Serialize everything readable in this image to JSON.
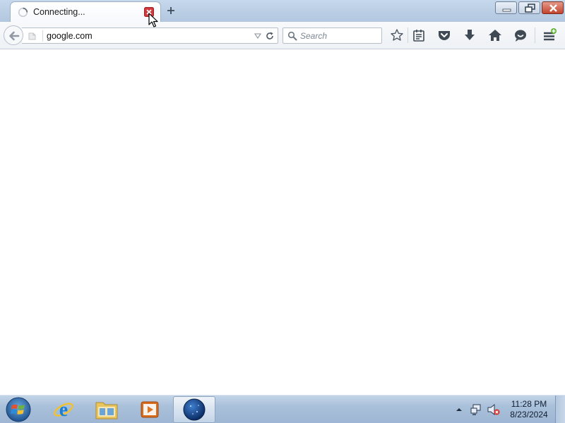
{
  "browser": {
    "tab": {
      "title": "Connecting...",
      "throbber_icon": "loading-throbber-icon",
      "close_icon": "close-tab-icon"
    },
    "new_tab_icon": "plus-icon",
    "window_controls": [
      "minimize",
      "restore",
      "close"
    ],
    "urlbar": {
      "value": "google.com",
      "identity_icon": "page-identity-icon",
      "dropdown_icon": "dropdown-arrow-icon",
      "reload_icon": "reload-icon"
    },
    "search": {
      "placeholder": "Search",
      "icon": "search-icon"
    },
    "toolbar_buttons": [
      "bookmark-star",
      "bookmarks-menu",
      "pocket",
      "downloads",
      "home",
      "hello",
      "menu"
    ],
    "menu_badge_color": "#5fb332"
  },
  "taskbar": {
    "pinned_apps": [
      "Internet Explorer",
      "Windows Explorer",
      "Windows Media Player",
      "Firefox"
    ],
    "active_app": "Firefox",
    "clock": {
      "time": "11:28 PM",
      "date": "8/23/2024"
    },
    "volume_muted": true
  },
  "colors": {
    "tab_strip": "#b9cde4",
    "taskbar": "#a9c0da",
    "close_button": "#c3442e",
    "tab_close": "#d1383c"
  }
}
